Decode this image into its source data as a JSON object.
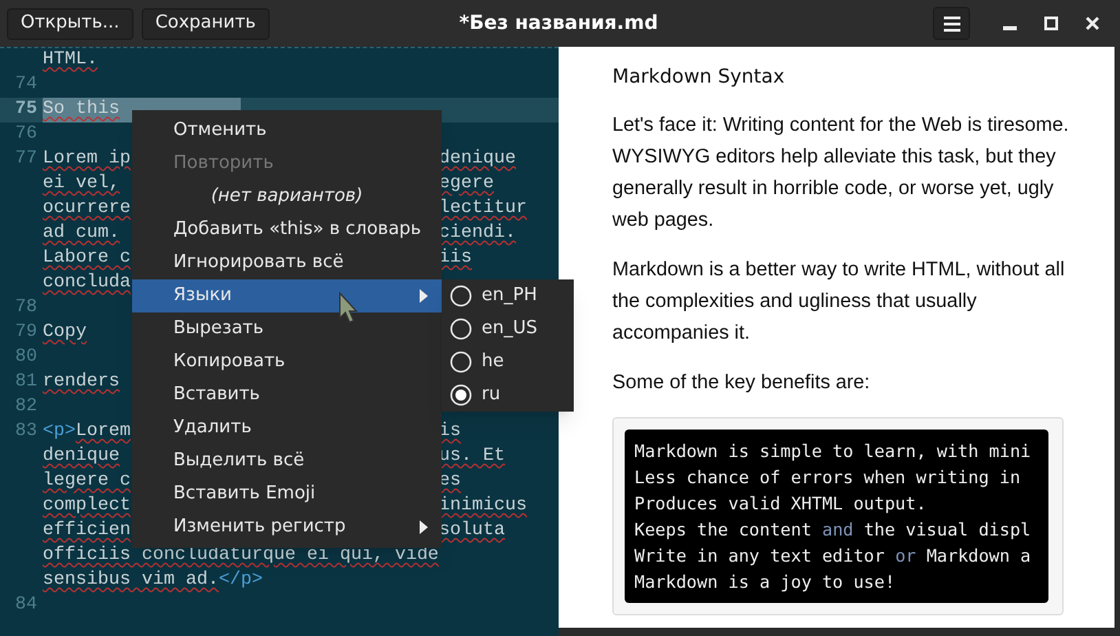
{
  "toolbar": {
    "buttons": [
      "Открыть...",
      "Сохранить"
    ]
  },
  "window": {
    "title": "*Без названия.md"
  },
  "editor": {
    "lines": [
      {
        "current": false,
        "left": [
          {
            "kind": "text",
            "text": "HTML."
          }
        ]
      },
      {
        "number": "74",
        "current": false
      },
      {
        "number": "75",
        "current": true,
        "left": [
          {
            "kind": "text",
            "text": "So this"
          }
        ]
      },
      {
        "number": "76",
        "current": false
      },
      {
        "number": "77",
        "current": false,
        "left": [
          {
            "kind": "text",
            "text": "Lorem ip"
          }
        ],
        "right": [
          {
            "kind": "text",
            "text": "denique"
          }
        ]
      },
      {
        "current": false,
        "left": [
          {
            "kind": "text",
            "text": "ei vel,"
          }
        ],
        "right": [
          {
            "kind": "text",
            "text": "egere"
          }
        ]
      },
      {
        "current": false,
        "left": [
          {
            "kind": "text",
            "text": "ocurrere"
          }
        ],
        "right": [
          {
            "kind": "text",
            "text": "lectitur"
          }
        ]
      },
      {
        "current": false,
        "left": [
          {
            "kind": "text",
            "text": "ad cum."
          }
        ],
        "right": [
          {
            "kind": "text",
            "text": "ciendi."
          }
        ]
      },
      {
        "current": false,
        "left": [
          {
            "kind": "text",
            "text": "Labore c"
          }
        ],
        "right": [
          {
            "kind": "text",
            "text": "iis"
          }
        ]
      },
      {
        "current": false,
        "left": [
          {
            "kind": "text",
            "text": "concluda"
          }
        ]
      },
      {
        "number": "78",
        "current": false
      },
      {
        "number": "79",
        "current": false,
        "left": [
          {
            "kind": "text",
            "text": "Copy"
          }
        ]
      },
      {
        "number": "80",
        "current": false
      },
      {
        "number": "81",
        "current": false,
        "left": [
          {
            "kind": "text",
            "text": "renders"
          }
        ]
      },
      {
        "number": "82",
        "current": false
      },
      {
        "number": "83",
        "current": false,
        "left": [
          {
            "kind": "tag",
            "text": "<p>"
          },
          {
            "kind": "text",
            "text": "Lorem"
          }
        ],
        "right": [
          {
            "kind": "text",
            "text": "is"
          }
        ]
      },
      {
        "current": false,
        "left": [
          {
            "kind": "text",
            "text": "denique"
          }
        ],
        "right": [
          {
            "kind": "text",
            "text": "us. Et"
          }
        ]
      },
      {
        "current": false,
        "left": [
          {
            "kind": "text",
            "text": "legere c"
          }
        ],
        "right": [
          {
            "kind": "text",
            "text": "es"
          }
        ]
      },
      {
        "current": false,
        "left": [
          {
            "kind": "text",
            "text": "complect"
          }
        ],
        "right": [
          {
            "kind": "text",
            "text": "inimicus"
          }
        ]
      },
      {
        "current": false,
        "left": [
          {
            "kind": "text",
            "text": "efficien"
          }
        ],
        "right": [
          {
            "kind": "text",
            "text": "soluta"
          }
        ]
      },
      {
        "current": false,
        "left": [
          {
            "kind": "text",
            "text": "officiis concludaturque ei qui, vide"
          }
        ]
      },
      {
        "current": false,
        "left": [
          {
            "kind": "text",
            "text": "sensibus vim ad."
          },
          {
            "kind": "tag",
            "text": "</p>"
          }
        ]
      },
      {
        "number": "84",
        "current": false
      }
    ]
  },
  "context_menu": {
    "items": [
      {
        "kind": "action",
        "label": "Отменить",
        "disabled": false,
        "highlighted": false
      },
      {
        "kind": "action",
        "label": "Повторить",
        "disabled": true,
        "highlighted": false
      },
      {
        "kind": "placeholder",
        "label": "(нет вариантов)",
        "disabled": false,
        "highlighted": false
      },
      {
        "kind": "action",
        "label": "Добавить «this» в словарь",
        "disabled": false,
        "highlighted": false
      },
      {
        "kind": "action",
        "label": "Игнорировать всё",
        "disabled": false,
        "highlighted": false
      },
      {
        "kind": "submenu",
        "label": "Языки",
        "disabled": false,
        "highlighted": true
      },
      {
        "kind": "action",
        "label": "Вырезать",
        "disabled": false,
        "highlighted": false
      },
      {
        "kind": "action",
        "label": "Копировать",
        "disabled": false,
        "highlighted": false
      },
      {
        "kind": "action",
        "label": "Вставить",
        "disabled": false,
        "highlighted": false
      },
      {
        "kind": "action",
        "label": "Удалить",
        "disabled": false,
        "highlighted": false
      },
      {
        "kind": "action",
        "label": "Выделить всё",
        "disabled": false,
        "highlighted": false
      },
      {
        "kind": "action",
        "label": "Вставить Emoji",
        "disabled": false,
        "highlighted": false
      },
      {
        "kind": "submenu",
        "label": "Изменить регистр",
        "disabled": false,
        "highlighted": false
      }
    ]
  },
  "language_submenu": {
    "items": [
      {
        "label": "en_PH",
        "selected": false
      },
      {
        "label": "en_US",
        "selected": false
      },
      {
        "label": "he",
        "selected": false
      },
      {
        "label": "ru",
        "selected": true
      }
    ]
  },
  "preview": {
    "heading": "Markdown Syntax",
    "paragraphs": [
      "Let's face it: Writing content for the Web is tiresome. WYSIWYG editors help alleviate this task, but they generally result in horrible code, or worse yet, ugly web pages.",
      "Markdown is a better way to write HTML, without all the complexities and ugliness that usually accompanies it.",
      "Some of the key benefits are:"
    ],
    "code_lines": [
      [
        {
          "kind": "text",
          "text": "Markdown is simple to learn, with mini"
        }
      ],
      [
        {
          "kind": "text",
          "text": "Less chance of errors when writing in"
        }
      ],
      [
        {
          "kind": "text",
          "text": "Produces valid XHTML output."
        }
      ],
      [
        {
          "kind": "text",
          "text": "Keeps the content "
        },
        {
          "kind": "keyword",
          "text": "and"
        },
        {
          "kind": "text",
          "text": " the visual displ"
        }
      ],
      [
        {
          "kind": "text",
          "text": "Write in any text editor "
        },
        {
          "kind": "keyword",
          "text": "or"
        },
        {
          "kind": "text",
          "text": " Markdown a"
        }
      ],
      [
        {
          "kind": "text",
          "text": "Markdown is a joy to use!"
        }
      ]
    ]
  }
}
